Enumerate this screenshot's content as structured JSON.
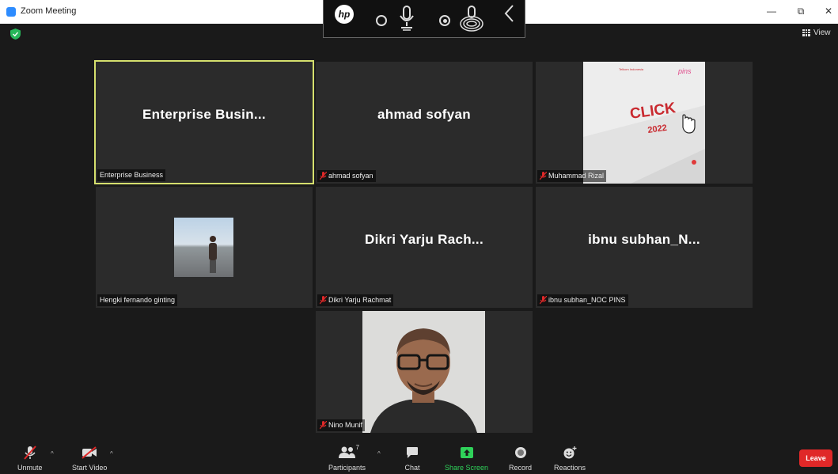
{
  "window": {
    "title": "Zoom Meeting",
    "minimize_glyph": "—",
    "restore_glyph": "⧉",
    "close_glyph": "✕"
  },
  "hp_toolbar": {
    "logo_text": "hp"
  },
  "view_button": {
    "label": "View"
  },
  "tiles": {
    "enterprise": {
      "center_name": "Enterprise  Busin...",
      "label": "Enterprise Business",
      "active": true
    },
    "ahmad": {
      "center_name": "ahmad sofyan",
      "label": "ahmad sofyan"
    },
    "rizal": {
      "label": "Muhammad Rizal",
      "share": {
        "brand_left": "Telkom Indonesia",
        "brand_right": "pins",
        "title": "CLICK",
        "year": "2022"
      }
    },
    "hengki": {
      "label": "Hengki fernando ginting"
    },
    "dikri": {
      "center_name": "Dikri Yarju Rach...",
      "label": "Dikri Yarju Rachmat"
    },
    "ibnu": {
      "center_name": "ibnu subhan_N...",
      "label": "ibnu subhan_NOC PINS"
    },
    "nino": {
      "label": "Nino Munif"
    }
  },
  "toolbar": {
    "unmute": "Unmute",
    "start_video": "Start Video",
    "participants": "Participants",
    "participants_count": "7",
    "chat": "Chat",
    "share_screen": "Share Screen",
    "record": "Record",
    "reactions": "Reactions",
    "leave": "Leave"
  },
  "icons": {
    "mic_muted": "mic-muted-icon",
    "video_off": "video-off-icon",
    "participants": "participants-icon",
    "chat": "chat-icon",
    "share": "share-screen-icon",
    "record": "record-icon",
    "reactions": "reactions-icon",
    "shield": "shield-icon",
    "grid": "grid-view-icon"
  },
  "colors": {
    "active_speaker_border": "#d5df6d",
    "share_green": "#2fd25a",
    "leave_red": "#e02828",
    "muted_red": "#e02828",
    "zoom_blue": "#2d8cff"
  }
}
